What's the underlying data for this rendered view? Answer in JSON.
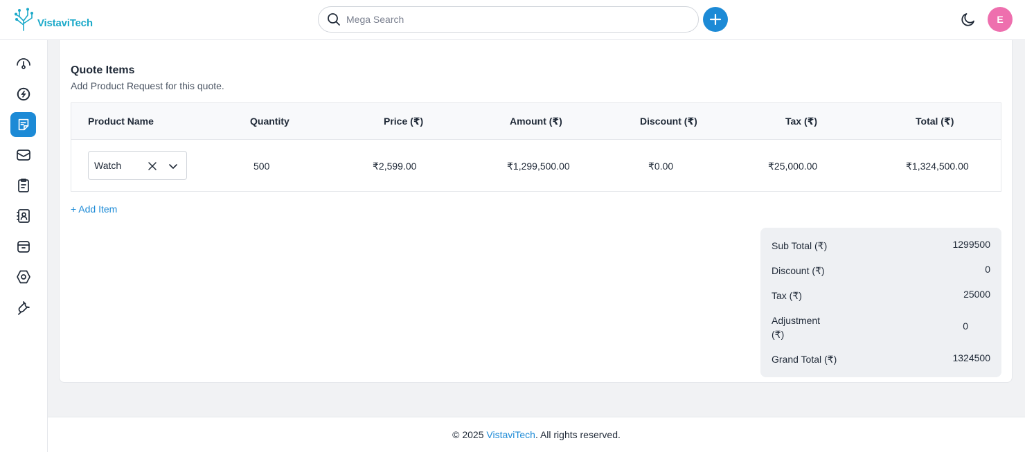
{
  "header": {
    "brand": "VistaviTech",
    "search_placeholder": "Mega Search",
    "avatar_initial": "E"
  },
  "colors": {
    "accent": "#1c8ad6",
    "brand": "#1ba9c9",
    "avatar": "#ee6fae"
  },
  "sidebar": {
    "items": [
      {
        "icon": "dashboard-gauge-icon",
        "active": false
      },
      {
        "icon": "integrations-icon",
        "active": false
      },
      {
        "icon": "notes-icon",
        "active": true
      },
      {
        "icon": "mail-icon",
        "active": false
      },
      {
        "icon": "document-icon",
        "active": false
      },
      {
        "icon": "contacts-icon",
        "active": false
      },
      {
        "icon": "archive-icon",
        "active": false
      },
      {
        "icon": "settings-hexagon-icon",
        "active": false
      },
      {
        "icon": "wrench-icon",
        "active": false
      }
    ]
  },
  "quote_items": {
    "title": "Quote Items",
    "subtitle": "Add Product Request for this quote.",
    "columns": [
      "Product Name",
      "Quantity",
      "Price (₹)",
      "Amount (₹)",
      "Discount (₹)",
      "Tax (₹)",
      "Total (₹)"
    ],
    "rows": [
      {
        "product": "Watch",
        "quantity": "500",
        "price": "₹2,599.00",
        "amount": "₹1,299,500.00",
        "discount": "₹0.00",
        "tax": "₹25,000.00",
        "total": "₹1,324,500.00"
      }
    ],
    "add_item_label": "+ Add Item"
  },
  "summary": {
    "sub_total_label": "Sub Total (₹)",
    "sub_total_value": "1299500",
    "discount_label": "Discount (₹)",
    "discount_value": "0",
    "tax_label": "Tax (₹)",
    "tax_value": "25000",
    "adjustment_label_1": "Adjustment",
    "adjustment_label_2": "(₹)",
    "adjustment_value": "0",
    "grand_total_label": "Grand Total (₹)",
    "grand_total_value": "1324500"
  },
  "footer": {
    "prefix": "© 2025 ",
    "brand": "VistaviTech",
    "suffix": ". All rights reserved."
  }
}
